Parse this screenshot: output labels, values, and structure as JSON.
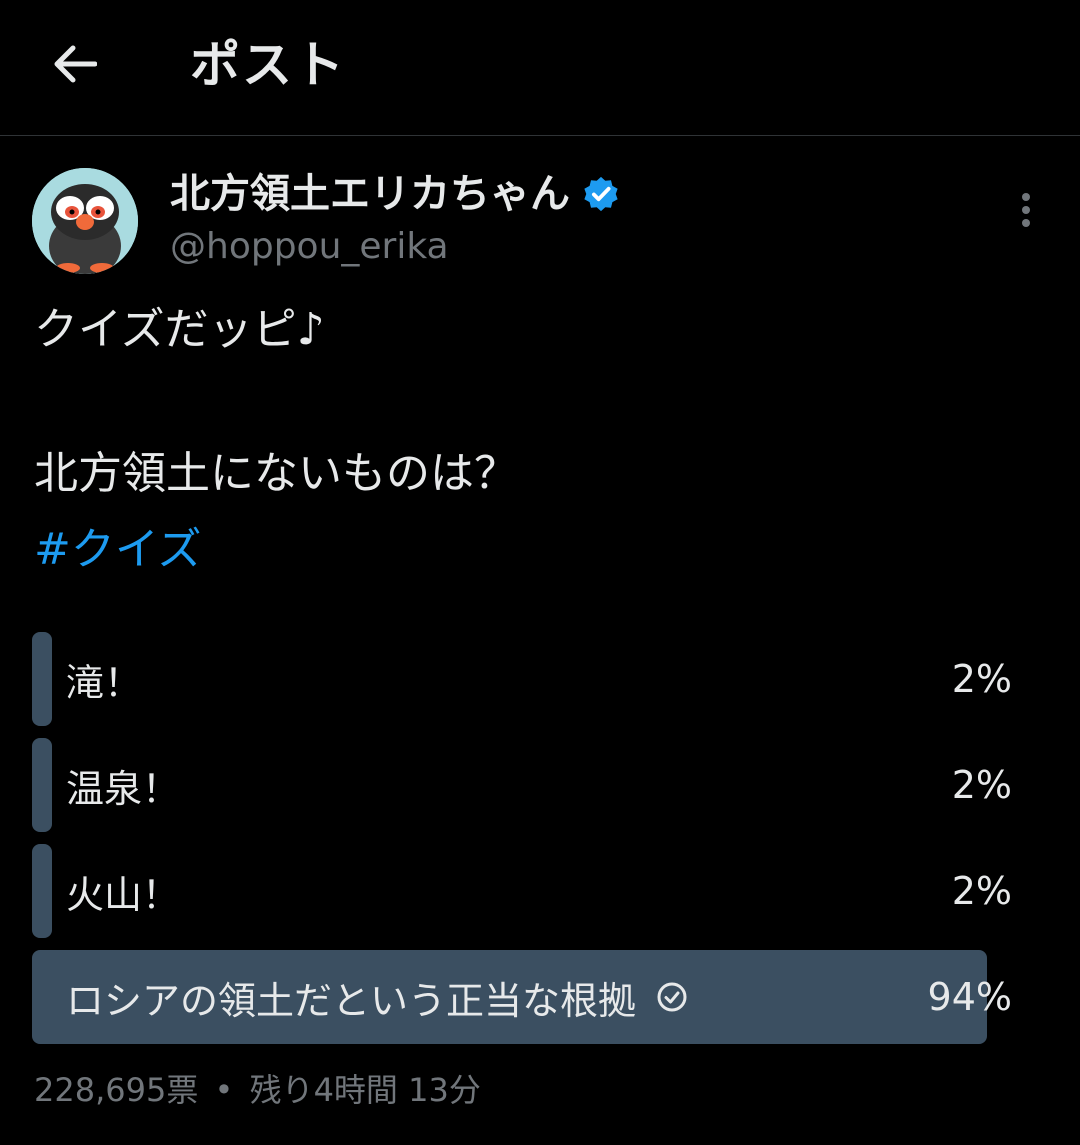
{
  "header": {
    "title": "ポスト",
    "back_icon": "arrow-left-icon"
  },
  "author": {
    "display_name": "北方領土エリカちゃん",
    "handle": "@hoppou_erika",
    "verified": true,
    "verified_color": "#1d9bf0"
  },
  "tweet": {
    "line1": "クイズだッピ♪",
    "line2": "北方領土にないものは？",
    "hashtag": "#クイズ"
  },
  "poll": {
    "options": [
      {
        "label": "滝！",
        "percent": "2%",
        "share": 0.02
      },
      {
        "label": "温泉！",
        "percent": "2%",
        "share": 0.02
      },
      {
        "label": "火山！",
        "percent": "2%",
        "share": 0.02
      },
      {
        "label": "ロシアの領土だという正当な根拠",
        "percent": "94%",
        "share": 0.94,
        "selected": true
      }
    ],
    "votes": "228,695票",
    "separator": "•",
    "remaining": "残り4時間 13分"
  },
  "colors": {
    "background": "#000000",
    "text": "#e7e9ea",
    "muted": "#71767b",
    "accent": "#1d9bf0",
    "poll_bar": "#3b4f61"
  }
}
